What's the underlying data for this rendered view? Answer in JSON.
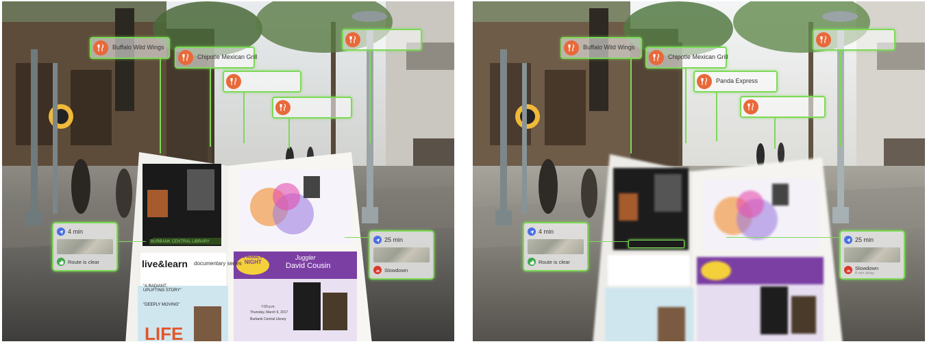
{
  "panels": [
    {
      "id": "left",
      "pois": [
        {
          "name": "Buffalo Wild Wings",
          "sub": "",
          "icon": "fork-knife-icon"
        },
        {
          "name": "Chipotle Mexican Grill",
          "sub": "",
          "icon": "fork-knife-icon"
        },
        {
          "name": "",
          "sub": "",
          "icon": "fork-knife-icon"
        },
        {
          "name": "",
          "sub": "",
          "icon": "fork-knife-icon"
        },
        {
          "name": "",
          "sub": "",
          "icon": "fork-knife-icon"
        }
      ],
      "nav_left": {
        "time": "4 min",
        "status": "Route is clear",
        "sub": ""
      },
      "nav_right": {
        "time": "25 min",
        "status": "Slowdown",
        "sub": ""
      }
    },
    {
      "id": "right",
      "pois": [
        {
          "name": "Buffalo Wild Wings",
          "sub": "",
          "icon": "fork-knife-icon"
        },
        {
          "name": "Chipotle Mexican Grill",
          "sub": "",
          "icon": "fork-knife-icon"
        },
        {
          "name": "Panda Express",
          "sub": "",
          "icon": "fork-knife-icon"
        },
        {
          "name": "",
          "sub": "",
          "icon": "fork-knife-icon"
        },
        {
          "name": "",
          "sub": "",
          "icon": "fork-knife-icon"
        }
      ],
      "nav_left": {
        "time": "4 min",
        "status": "Route is clear",
        "sub": ""
      },
      "nav_right": {
        "time": "25 min",
        "status": "Slowdown",
        "sub": "8 min delay"
      }
    }
  ],
  "flyer": {
    "left_page": {
      "logo": "live&learn",
      "logo_sub": "documentary series",
      "quote1": "\"A RADIANT, UPLIFTING STORY\"",
      "quote2": "\"DEEPLY MOVING\"",
      "film_title": "LIFE"
    },
    "right_page": {
      "badge_line1": "FAMILY",
      "badge_line2": "NIGHT",
      "act_kicker": "Juggler",
      "act_name": "David Cousin",
      "event_time": "7:00 p.m.",
      "event_date": "Thursday, March 9, 2017",
      "venue": "Burbank Central Library"
    },
    "strip_label": "BURBANK CENTRAL LIBRARY"
  },
  "colors": {
    "accent": "#7ed957",
    "poi_icon": "#e8693a",
    "purple": "#7b3fa3",
    "route_clear": "#3ea84a",
    "slowdown": "#d9392b",
    "nav_time": "#4a6fe3"
  }
}
